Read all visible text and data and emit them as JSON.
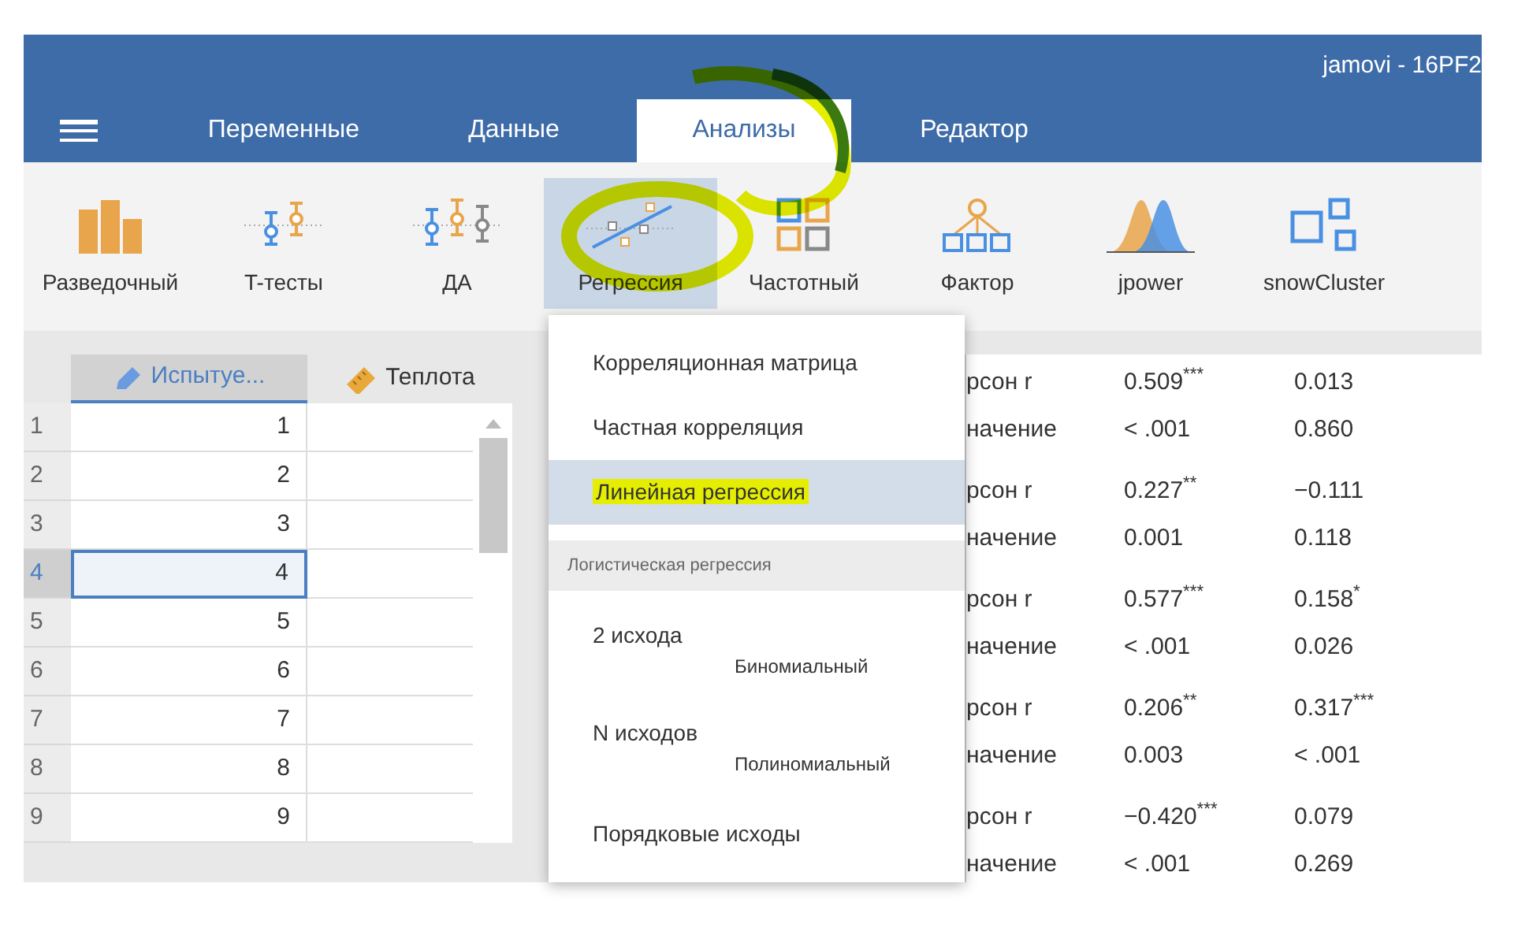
{
  "window": {
    "title": "jamovi - 16PF2"
  },
  "tabs": [
    {
      "label": "Переменные",
      "selected": false
    },
    {
      "label": "Данные",
      "selected": false
    },
    {
      "label": "Анализы",
      "selected": true
    },
    {
      "label": "Редактор",
      "selected": false
    }
  ],
  "toolbar": [
    {
      "label": "Разведочный",
      "kind": "bars",
      "selected": false
    },
    {
      "label": "T-тесты",
      "kind": "ttest",
      "selected": false
    },
    {
      "label": "ДА",
      "kind": "anova",
      "selected": false
    },
    {
      "label": "Регрессия",
      "kind": "regression",
      "selected": true
    },
    {
      "label": "Частотный",
      "kind": "frequencies",
      "selected": false
    },
    {
      "label": "Фактор",
      "kind": "factor",
      "selected": false
    },
    {
      "label": "jpower",
      "kind": "jpower",
      "selected": false
    },
    {
      "label": "snowCluster",
      "kind": "cluster",
      "selected": false
    }
  ],
  "data_grid": {
    "columns": [
      {
        "name": "Испытуе...",
        "kind": "nominal",
        "selected": true
      },
      {
        "name": "Теплота",
        "kind": "continuous",
        "selected": false
      }
    ],
    "rows": [
      {
        "number": "1",
        "value": "1",
        "selected": false
      },
      {
        "number": "2",
        "value": "2",
        "selected": false
      },
      {
        "number": "3",
        "value": "3",
        "selected": false
      },
      {
        "number": "4",
        "value": "4",
        "selected": true
      },
      {
        "number": "5",
        "value": "5",
        "selected": false
      },
      {
        "number": "6",
        "value": "6",
        "selected": false
      },
      {
        "number": "7",
        "value": "7",
        "selected": false
      },
      {
        "number": "8",
        "value": "8",
        "selected": false
      },
      {
        "number": "9",
        "value": "9",
        "selected": false
      }
    ]
  },
  "menu": {
    "items": [
      {
        "kind": "item",
        "label": "Корреляционная матрица",
        "selected": false
      },
      {
        "kind": "item",
        "label": "Частная корреляция",
        "selected": false
      },
      {
        "kind": "item",
        "label": "Линейная регрессия",
        "selected": true
      },
      {
        "kind": "header",
        "label": "Логистическая регрессия"
      },
      {
        "kind": "sub",
        "label": "2 исхода",
        "sublabel": "Биномиальный"
      },
      {
        "kind": "sub",
        "label": "N исходов",
        "sublabel": "Полиномиальный"
      },
      {
        "kind": "item",
        "label": "Порядковые исходы",
        "selected": false
      }
    ]
  },
  "results": {
    "groups": [
      [
        {
          "label": "рсон r",
          "values": [
            "0.509$^{***}$",
            "0.013"
          ]
        },
        {
          "label": "начение",
          "values": [
            "< .001",
            "0.860"
          ]
        }
      ],
      [
        {
          "label": "рсон r",
          "values": [
            "0.227$^{**}$",
            "−0.111"
          ]
        },
        {
          "label": "начение",
          "values": [
            "0.001",
            "0.118"
          ]
        }
      ],
      [
        {
          "label": "рсон r",
          "values": [
            "0.577$^{***}$",
            "0.158$^{*}$"
          ]
        },
        {
          "label": "начение",
          "values": [
            "< .001",
            "0.026"
          ]
        }
      ],
      [
        {
          "label": "рсон r",
          "values": [
            "0.206$^{**}$",
            "0.317$^{***}$"
          ]
        },
        {
          "label": "начение",
          "values": [
            "0.003",
            "< .001"
          ]
        }
      ],
      [
        {
          "label": "рсон r",
          "values": [
            "−0.420$^{***}$",
            "0.079"
          ]
        },
        {
          "label": "начение",
          "values": [
            "< .001",
            "0.269"
          ]
        }
      ]
    ]
  }
}
